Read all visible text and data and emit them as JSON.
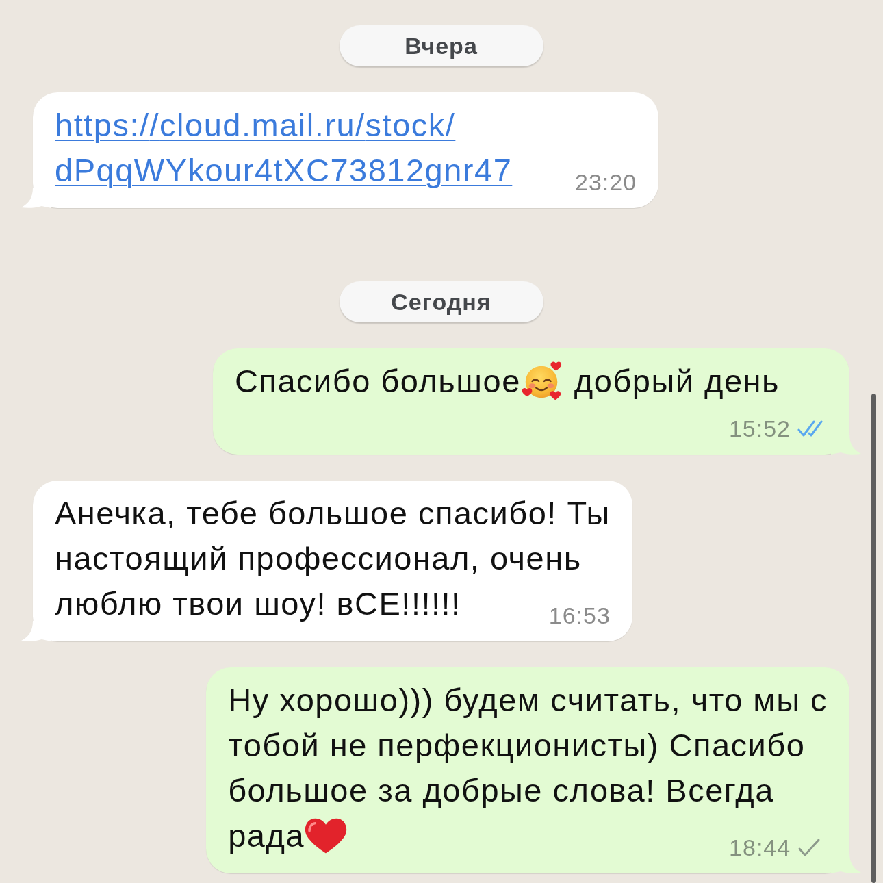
{
  "chat": [
    {
      "kind": "date",
      "label": "Вчера"
    },
    {
      "kind": "incoming",
      "lines": [
        [
          {
            "kind": "link",
            "text": "https://cloud.mail.ru/stock/dPqqWYkour4tXC73812gnr47"
          }
        ]
      ],
      "time": "23:20"
    },
    {
      "kind": "date",
      "label": "Сегодня"
    },
    {
      "kind": "outgoing",
      "lines": [
        [
          {
            "kind": "text",
            "text": "Спасибо большое"
          },
          {
            "kind": "smiley"
          },
          {
            "kind": "text",
            "text": "добрый день"
          }
        ]
      ],
      "time": "15:52",
      "read": true
    },
    {
      "kind": "incoming",
      "lines": [
        [
          {
            "kind": "text",
            "text": "Анечка, тебе большое спасибо! Ты"
          }
        ],
        [
          {
            "kind": "text",
            "text": "настоящий профессионал, очень"
          }
        ],
        [
          {
            "kind": "text",
            "text": "люблю твои шоу! вСЕ!!!!!!"
          }
        ]
      ],
      "time": "16:53"
    },
    {
      "kind": "outgoing",
      "lines": [
        [
          {
            "kind": "text",
            "text": "Ну хорошо))) будем считать, что мы с"
          }
        ],
        [
          {
            "kind": "text",
            "text": "тобой не перфекционисты) Спасибо"
          }
        ],
        [
          {
            "kind": "text",
            "text": "большое за добрые слова! Всегда"
          }
        ],
        [
          {
            "kind": "text",
            "text": "рада"
          },
          {
            "kind": "heart"
          }
        ]
      ],
      "time": "18:44",
      "read": false
    }
  ]
}
